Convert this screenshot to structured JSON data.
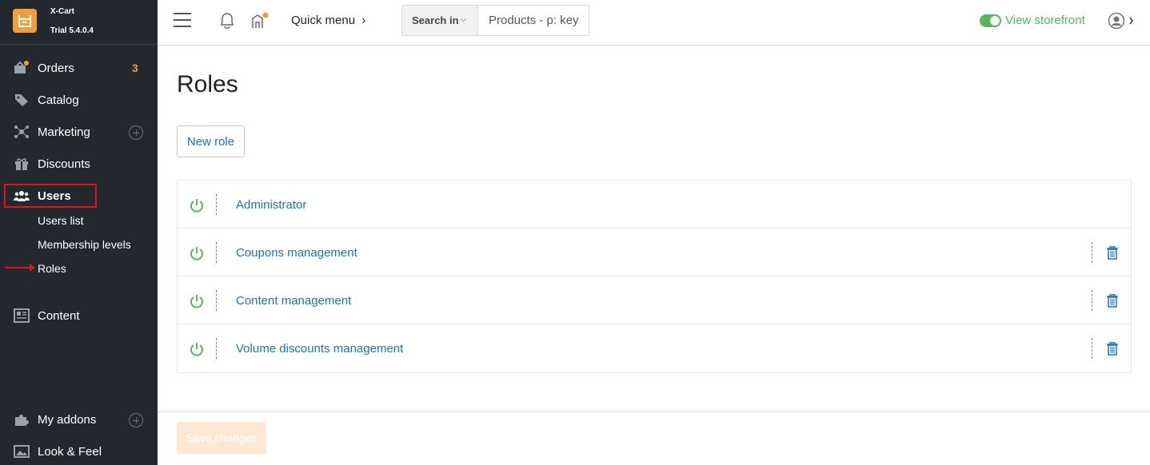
{
  "brand": {
    "name": "X-Cart",
    "version": "Trial 5.4.0.4"
  },
  "sidebar": {
    "items": [
      {
        "label": "Orders",
        "badge": "3",
        "icon": "orders-icon"
      },
      {
        "label": "Catalog",
        "icon": "tag-icon"
      },
      {
        "label": "Marketing",
        "icon": "marketing-icon"
      },
      {
        "label": "Discounts",
        "icon": "gift-icon"
      },
      {
        "label": "Users",
        "icon": "users-icon"
      },
      {
        "label": "Content",
        "icon": "content-icon"
      },
      {
        "label": "My addons",
        "icon": "puzzle-icon"
      },
      {
        "label": "Look & Feel",
        "icon": "image-icon"
      }
    ],
    "users_sub": [
      "Users list",
      "Membership levels",
      "Roles"
    ]
  },
  "topbar": {
    "quick_menu": "Quick menu",
    "search_in": "Search in",
    "search_placeholder": "Products - p: key",
    "view_storefront": "View storefront"
  },
  "main": {
    "title": "Roles",
    "new_role_label": "New role",
    "roles": [
      {
        "name": "Administrator",
        "enabled": true,
        "deletable": false
      },
      {
        "name": "Coupons management",
        "enabled": true,
        "deletable": true
      },
      {
        "name": "Content management",
        "enabled": true,
        "deletable": true
      },
      {
        "name": "Volume discounts management",
        "enabled": true,
        "deletable": true
      }
    ],
    "save_label": "Save changes"
  },
  "colors": {
    "sidebar_bg": "#22282d",
    "accent_orange": "#f29e3b",
    "link_blue": "#1a72b5",
    "green": "#59b35e",
    "highlight_red": "#e1141e"
  }
}
